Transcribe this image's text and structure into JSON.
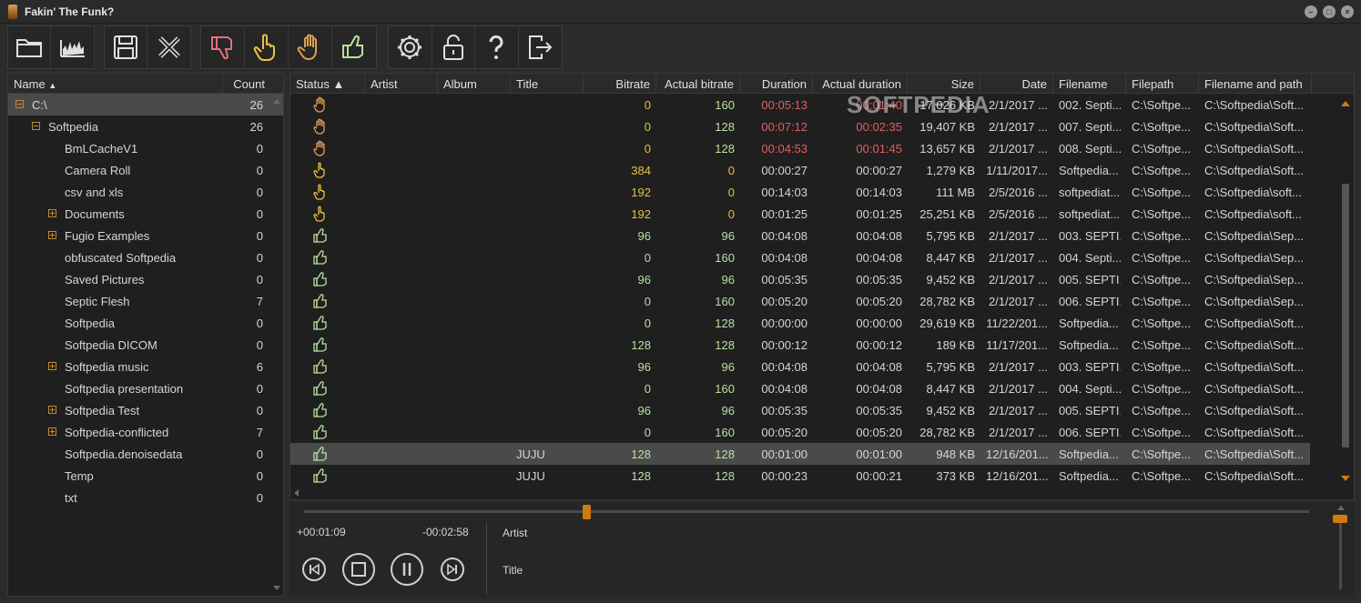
{
  "window": {
    "title": "Fakin' The Funk?"
  },
  "watermark": "SOFTPEDIA",
  "colors": {
    "accent": "#d07a10",
    "value_yellow": "#e8c040",
    "value_green": "#b8e0a0",
    "value_red": "#e06060",
    "thumbs_up": "#b8e0a0",
    "hand_stop": "#e0a050",
    "hand_point": "#f0c040",
    "thumbs_down": "#e07080"
  },
  "toolbar": {
    "groups": [
      {
        "buttons": [
          {
            "icon": "folder-icon"
          },
          {
            "icon": "spectrum-icon"
          }
        ]
      },
      {
        "buttons": [
          {
            "icon": "save-icon"
          },
          {
            "icon": "close-x-icon"
          }
        ]
      },
      {
        "buttons": [
          {
            "icon": "thumbs-down-icon"
          },
          {
            "icon": "hand-point-icon"
          },
          {
            "icon": "hand-stop-icon"
          },
          {
            "icon": "thumbs-up-icon"
          }
        ]
      },
      {
        "buttons": [
          {
            "icon": "gear-icon"
          },
          {
            "icon": "lock-icon"
          },
          {
            "icon": "help-icon"
          },
          {
            "icon": "exit-icon"
          }
        ]
      }
    ]
  },
  "tree": {
    "header": {
      "name": "Name",
      "count": "Count"
    },
    "rows": [
      {
        "label": "C:\\",
        "count": "26",
        "level": 0,
        "expander": "minus",
        "selected": true
      },
      {
        "label": "Softpedia",
        "count": "26",
        "level": 1,
        "expander": "minus"
      },
      {
        "label": "BmLCacheV1",
        "count": "0",
        "level": 2
      },
      {
        "label": "Camera Roll",
        "count": "0",
        "level": 2
      },
      {
        "label": "csv and xls",
        "count": "0",
        "level": 2
      },
      {
        "label": "Documents",
        "count": "0",
        "level": 2,
        "expander": "plus"
      },
      {
        "label": "Fugio Examples",
        "count": "0",
        "level": 2,
        "expander": "plus"
      },
      {
        "label": "obfuscated Softpedia",
        "count": "0",
        "level": 2
      },
      {
        "label": "Saved Pictures",
        "count": "0",
        "level": 2
      },
      {
        "label": "Septic Flesh",
        "count": "7",
        "level": 2
      },
      {
        "label": "Softpedia",
        "count": "0",
        "level": 2
      },
      {
        "label": "Softpedia DICOM",
        "count": "0",
        "level": 2
      },
      {
        "label": "Softpedia music",
        "count": "6",
        "level": 2,
        "expander": "plus"
      },
      {
        "label": "Softpedia presentation",
        "count": "0",
        "level": 2
      },
      {
        "label": "Softpedia Test",
        "count": "0",
        "level": 2,
        "expander": "plus"
      },
      {
        "label": "Softpedia-conflicted",
        "count": "7",
        "level": 2,
        "expander": "plus"
      },
      {
        "label": "Softpedia.denoisedata",
        "count": "0",
        "level": 2
      },
      {
        "label": "Temp",
        "count": "0",
        "level": 2
      },
      {
        "label": "txt",
        "count": "0",
        "level": 2
      }
    ]
  },
  "grid": {
    "columns": [
      "Status",
      "Artist",
      "Album",
      "Title",
      "Bitrate",
      "Actual bitrate",
      "Duration",
      "Actual duration",
      "Size",
      "Date",
      "Filename",
      "Filepath",
      "Filename and path"
    ],
    "rows": [
      {
        "status": "hand-stop-icon",
        "title": "",
        "bitrate": "0",
        "actual_bitrate": "160",
        "duration": "00:05:13",
        "actual_duration": "00:01:40",
        "size": "17,026 KB",
        "date": "2/1/2017 ...",
        "filename": "002. Septi...",
        "filepath": "C:\\Softpe...",
        "fullpath": "C:\\Softpedia\\Soft...",
        "cb": "yellow",
        "cab": "green",
        "cd": "red",
        "cad": "red"
      },
      {
        "status": "hand-stop-icon",
        "title": "",
        "bitrate": "0",
        "actual_bitrate": "128",
        "duration": "00:07:12",
        "actual_duration": "00:02:35",
        "size": "19,407 KB",
        "date": "2/1/2017 ...",
        "filename": "007. Septi...",
        "filepath": "C:\\Softpe...",
        "fullpath": "C:\\Softpedia\\Soft...",
        "cb": "yellow",
        "cab": "green",
        "cd": "red",
        "cad": "red"
      },
      {
        "status": "hand-stop-icon",
        "title": "",
        "bitrate": "0",
        "actual_bitrate": "128",
        "duration": "00:04:53",
        "actual_duration": "00:01:45",
        "size": "13,657 KB",
        "date": "2/1/2017 ...",
        "filename": "008. Septi...",
        "filepath": "C:\\Softpe...",
        "fullpath": "C:\\Softpedia\\Soft...",
        "cb": "yellow",
        "cab": "green",
        "cd": "red",
        "cad": "red"
      },
      {
        "status": "hand-point-icon",
        "title": "",
        "bitrate": "384",
        "actual_bitrate": "0",
        "duration": "00:00:27",
        "actual_duration": "00:00:27",
        "size": "1,279 KB",
        "date": "1/11/2017...",
        "filename": "Softpedia...",
        "filepath": "C:\\Softpe...",
        "fullpath": "C:\\Softpedia\\Soft...",
        "cb": "yellow",
        "cab": "yellow",
        "cd": "plain",
        "cad": "plain"
      },
      {
        "status": "hand-point-icon",
        "title": "",
        "bitrate": "192",
        "actual_bitrate": "0",
        "duration": "00:14:03",
        "actual_duration": "00:14:03",
        "size": "111 MB",
        "date": "2/5/2016 ...",
        "filename": "softpediat...",
        "filepath": "C:\\Softpe...",
        "fullpath": "C:\\Softpedia\\soft...",
        "cb": "yellow",
        "cab": "yellow",
        "cd": "plain",
        "cad": "plain"
      },
      {
        "status": "hand-point-icon",
        "title": "",
        "bitrate": "192",
        "actual_bitrate": "0",
        "duration": "00:01:25",
        "actual_duration": "00:01:25",
        "size": "25,251 KB",
        "date": "2/5/2016 ...",
        "filename": "softpediat...",
        "filepath": "C:\\Softpe...",
        "fullpath": "C:\\Softpedia\\soft...",
        "cb": "yellow",
        "cab": "yellow",
        "cd": "plain",
        "cad": "plain"
      },
      {
        "status": "thumbs-up-icon",
        "title": "",
        "bitrate": "96",
        "actual_bitrate": "96",
        "duration": "00:04:08",
        "actual_duration": "00:04:08",
        "size": "5,795 KB",
        "date": "2/1/2017 ...",
        "filename": "003. SEPTI...",
        "filepath": "C:\\Softpe...",
        "fullpath": "C:\\Softpedia\\Sep...",
        "cb": "green",
        "cab": "green",
        "cd": "plain",
        "cad": "plain"
      },
      {
        "status": "thumbs-up-icon",
        "title": "",
        "bitrate": "0",
        "actual_bitrate": "160",
        "duration": "00:04:08",
        "actual_duration": "00:04:08",
        "size": "8,447 KB",
        "date": "2/1/2017 ...",
        "filename": "004. Septi...",
        "filepath": "C:\\Softpe...",
        "fullpath": "C:\\Softpedia\\Sep...",
        "cb": "green",
        "cab": "green",
        "cd": "plain",
        "cad": "plain"
      },
      {
        "status": "thumbs-up-icon",
        "title": "",
        "bitrate": "96",
        "actual_bitrate": "96",
        "duration": "00:05:35",
        "actual_duration": "00:05:35",
        "size": "9,452 KB",
        "date": "2/1/2017 ...",
        "filename": "005. SEPTI...",
        "filepath": "C:\\Softpe...",
        "fullpath": "C:\\Softpedia\\Sep...",
        "cb": "green",
        "cab": "green",
        "cd": "plain",
        "cad": "plain"
      },
      {
        "status": "thumbs-up-icon",
        "title": "",
        "bitrate": "0",
        "actual_bitrate": "160",
        "duration": "00:05:20",
        "actual_duration": "00:05:20",
        "size": "28,782 KB",
        "date": "2/1/2017 ...",
        "filename": "006. SEPTI...",
        "filepath": "C:\\Softpe...",
        "fullpath": "C:\\Softpedia\\Sep...",
        "cb": "green",
        "cab": "green",
        "cd": "plain",
        "cad": "plain"
      },
      {
        "status": "thumbs-up-icon",
        "title": "",
        "bitrate": "0",
        "actual_bitrate": "128",
        "duration": "00:00:00",
        "actual_duration": "00:00:00",
        "size": "29,619 KB",
        "date": "11/22/201...",
        "filename": "Softpedia...",
        "filepath": "C:\\Softpe...",
        "fullpath": "C:\\Softpedia\\Soft...",
        "cb": "green",
        "cab": "green",
        "cd": "plain",
        "cad": "plain"
      },
      {
        "status": "thumbs-up-icon",
        "title": "",
        "bitrate": "128",
        "actual_bitrate": "128",
        "duration": "00:00:12",
        "actual_duration": "00:00:12",
        "size": "189 KB",
        "date": "11/17/201...",
        "filename": "Softpedia...",
        "filepath": "C:\\Softpe...",
        "fullpath": "C:\\Softpedia\\Soft...",
        "cb": "green",
        "cab": "green",
        "cd": "plain",
        "cad": "plain"
      },
      {
        "status": "thumbs-up-icon",
        "title": "",
        "bitrate": "96",
        "actual_bitrate": "96",
        "duration": "00:04:08",
        "actual_duration": "00:04:08",
        "size": "5,795 KB",
        "date": "2/1/2017 ...",
        "filename": "003. SEPTI...",
        "filepath": "C:\\Softpe...",
        "fullpath": "C:\\Softpedia\\Soft...",
        "cb": "green",
        "cab": "green",
        "cd": "plain",
        "cad": "plain"
      },
      {
        "status": "thumbs-up-icon",
        "title": "",
        "bitrate": "0",
        "actual_bitrate": "160",
        "duration": "00:04:08",
        "actual_duration": "00:04:08",
        "size": "8,447 KB",
        "date": "2/1/2017 ...",
        "filename": "004. Septi...",
        "filepath": "C:\\Softpe...",
        "fullpath": "C:\\Softpedia\\Soft...",
        "cb": "green",
        "cab": "green",
        "cd": "plain",
        "cad": "plain"
      },
      {
        "status": "thumbs-up-icon",
        "title": "",
        "bitrate": "96",
        "actual_bitrate": "96",
        "duration": "00:05:35",
        "actual_duration": "00:05:35",
        "size": "9,452 KB",
        "date": "2/1/2017 ...",
        "filename": "005. SEPTI...",
        "filepath": "C:\\Softpe...",
        "fullpath": "C:\\Softpedia\\Soft...",
        "cb": "green",
        "cab": "green",
        "cd": "plain",
        "cad": "plain"
      },
      {
        "status": "thumbs-up-icon",
        "title": "",
        "bitrate": "0",
        "actual_bitrate": "160",
        "duration": "00:05:20",
        "actual_duration": "00:05:20",
        "size": "28,782 KB",
        "date": "2/1/2017 ...",
        "filename": "006. SEPTI...",
        "filepath": "C:\\Softpe...",
        "fullpath": "C:\\Softpedia\\Soft...",
        "cb": "green",
        "cab": "green",
        "cd": "plain",
        "cad": "plain"
      },
      {
        "status": "thumbs-up-icon",
        "title": "JUJU",
        "bitrate": "128",
        "actual_bitrate": "128",
        "duration": "00:01:00",
        "actual_duration": "00:01:00",
        "size": "948 KB",
        "date": "12/16/201...",
        "filename": "Softpedia...",
        "filepath": "C:\\Softpe...",
        "fullpath": "C:\\Softpedia\\Soft...",
        "cb": "green",
        "cab": "green",
        "cd": "plain",
        "cad": "plain",
        "selected": true
      },
      {
        "status": "thumbs-up-icon",
        "title": "JUJU",
        "bitrate": "128",
        "actual_bitrate": "128",
        "duration": "00:00:23",
        "actual_duration": "00:00:21",
        "size": "373 KB",
        "date": "12/16/201...",
        "filename": "Softpedia...",
        "filepath": "C:\\Softpe...",
        "fullpath": "C:\\Softpedia\\Soft...",
        "cb": "green",
        "cab": "green",
        "cd": "plain",
        "cad": "plain"
      }
    ]
  },
  "player": {
    "elapsed": "+00:01:09",
    "remaining": "-00:02:58",
    "artist_label": "Artist",
    "title_label": "Title",
    "buttons": [
      "previous-icon",
      "stop-icon",
      "pause-icon",
      "next-icon"
    ]
  }
}
